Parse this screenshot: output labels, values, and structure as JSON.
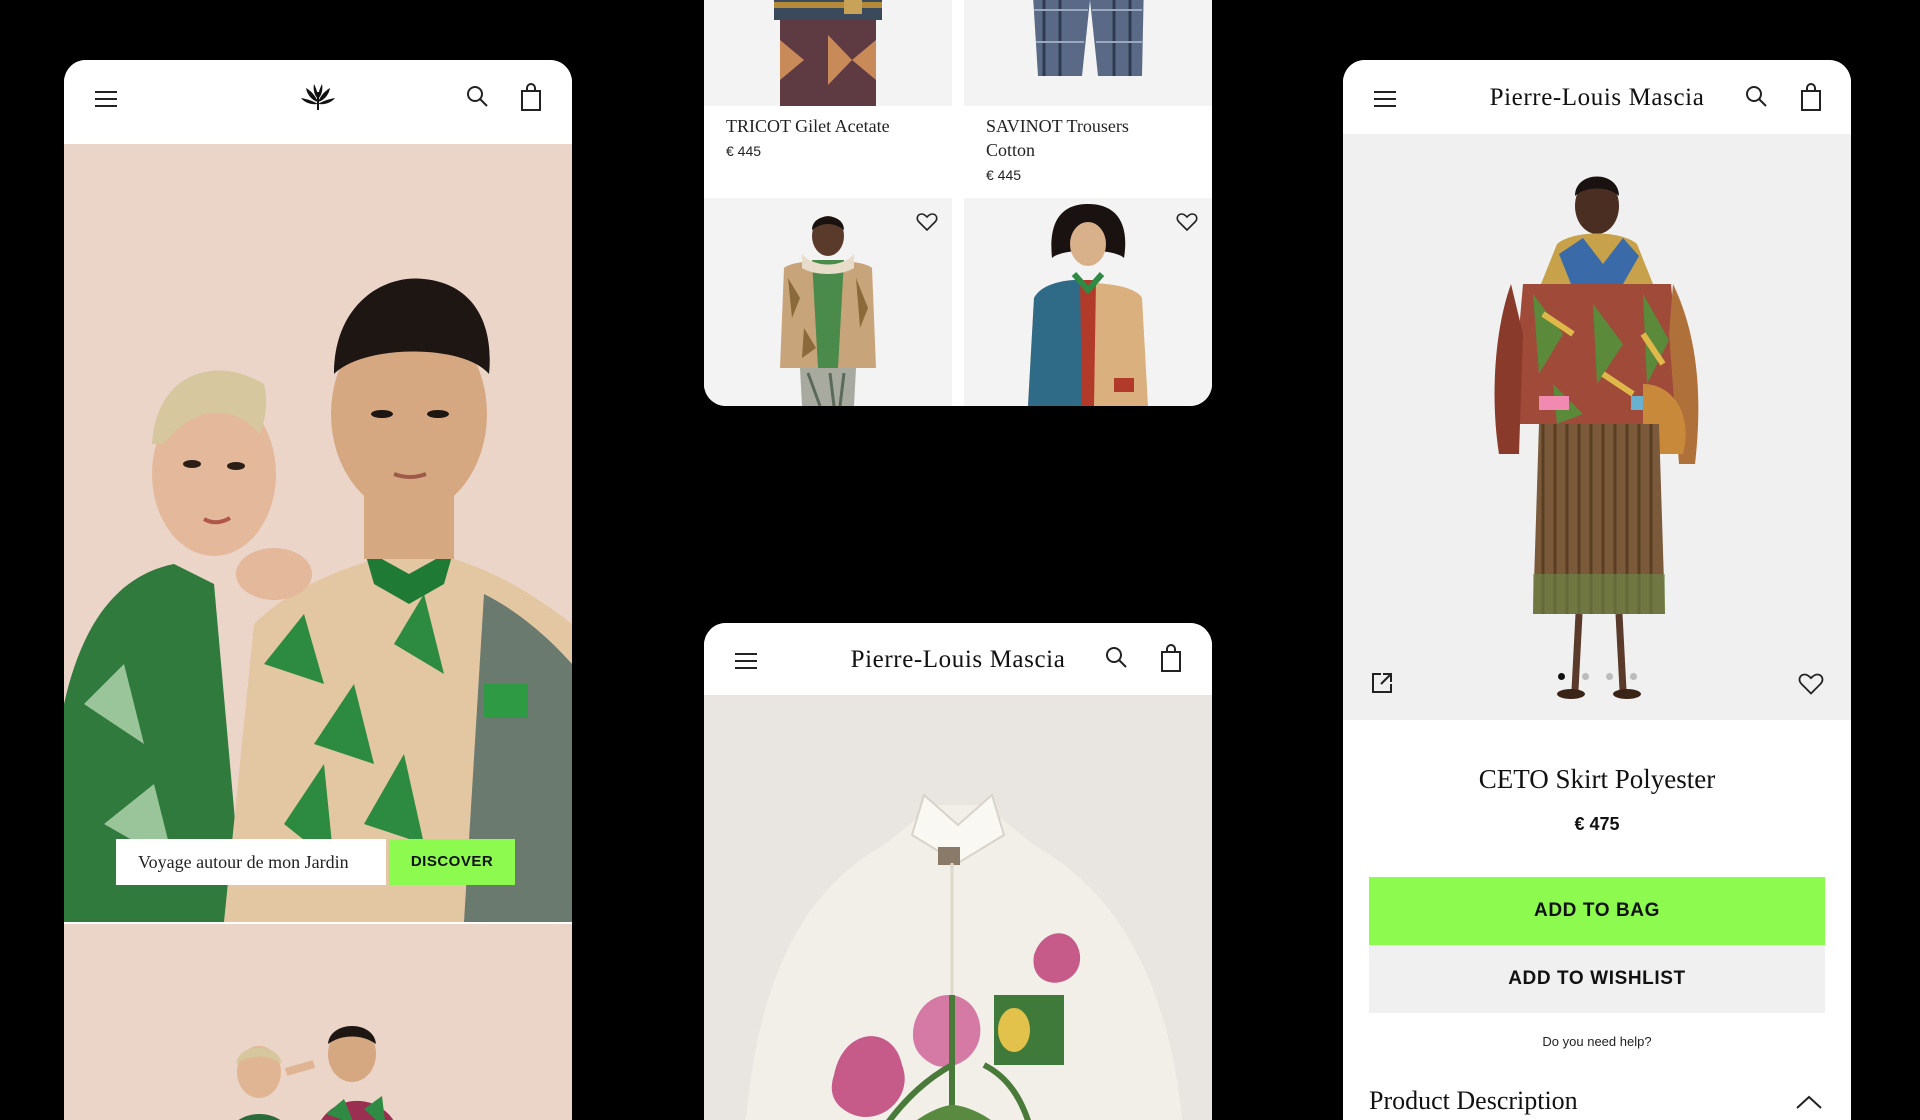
{
  "screen1": {
    "banner_label": "Voyage autour de mon Jardin",
    "banner_button": "DISCOVER"
  },
  "screen2": {
    "products": [
      {
        "name": "TRICOT Gilet Acetate",
        "price": "€ 445"
      },
      {
        "name": "SAVINOT Trousers Cotton",
        "price": "€ 445"
      }
    ]
  },
  "screen3": {
    "brand": "Pierre-Louis Mascia"
  },
  "screen4": {
    "brand": "Pierre-Louis Mascia",
    "product_name": "CETO Skirt Polyester",
    "price": "€ 475",
    "add_to_bag": "ADD TO BAG",
    "add_to_wishlist": "ADD TO WISHLIST",
    "help": "Do you need help?",
    "section_title": "Product Description",
    "carousel_total": 4,
    "carousel_active": 1
  },
  "colors": {
    "background": "#000000",
    "accent_green": "#8cfa4f",
    "panel": "#ffffff",
    "secondary_button": "#f0f0f0"
  }
}
